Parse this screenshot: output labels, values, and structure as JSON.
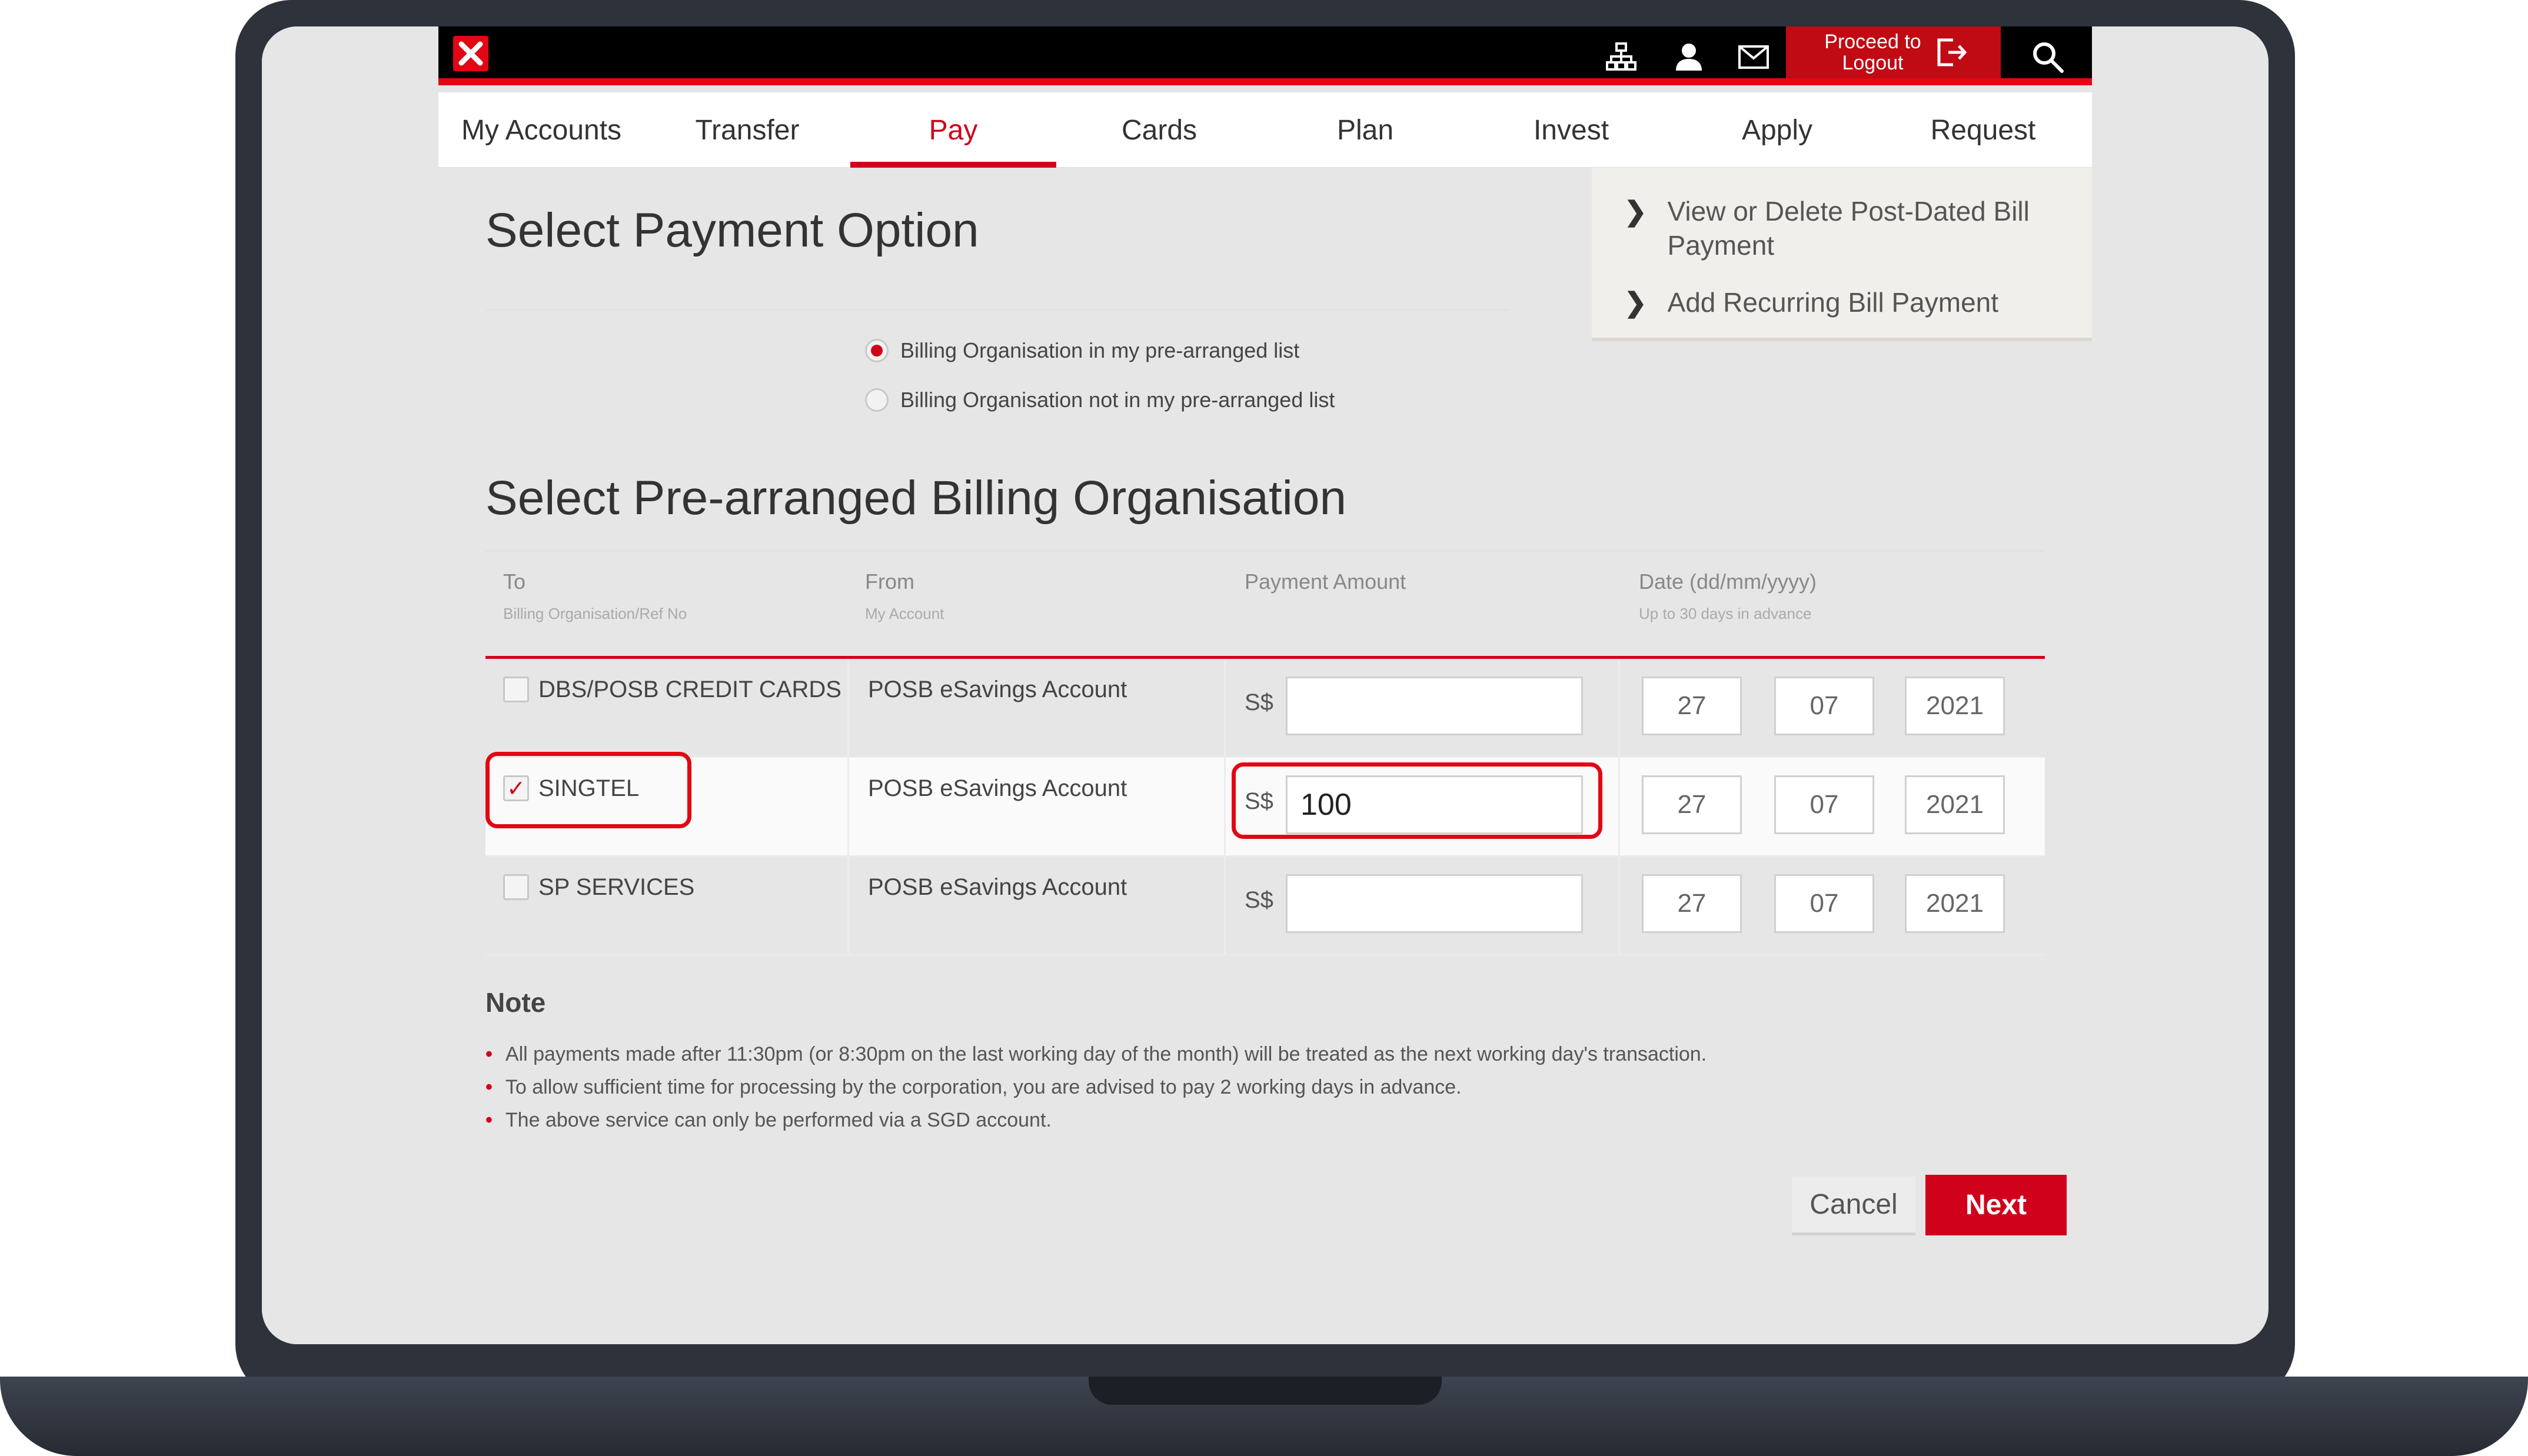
{
  "header": {
    "logout_line1": "Proceed to",
    "logout_line2": "Logout",
    "icons": [
      "sitemap-icon",
      "profile-icon",
      "mail-icon",
      "logout-icon",
      "search-icon"
    ],
    "brand_color": "#d0021b"
  },
  "nav": {
    "items": [
      "My Accounts",
      "Transfer",
      "Pay",
      "Cards",
      "Plan",
      "Invest",
      "Apply",
      "Request"
    ],
    "active": "Pay"
  },
  "payment_option": {
    "title": "Select Payment Option",
    "options": [
      {
        "label": "Billing Organisation in my pre-arranged list",
        "selected": true
      },
      {
        "label": "Billing Organisation not in my pre-arranged list",
        "selected": false
      }
    ]
  },
  "side_links": [
    "View or Delete Post-Dated Bill Payment",
    "Add Recurring Bill Payment"
  ],
  "billing": {
    "title": "Select Pre-arranged Billing Organisation",
    "headers": {
      "to": "To",
      "to_sub": "Billing Organisation/Ref No",
      "from": "From",
      "from_sub": "My Account",
      "amount": "Payment Amount",
      "date": "Date (dd/mm/yyyy)",
      "date_sub": "Up to 30 days in advance"
    },
    "rows": [
      {
        "org": "DBS/POSB CREDIT CARDS",
        "checked": false,
        "from": "POSB eSavings Account",
        "currency": "S$",
        "amount": "",
        "dd": "27",
        "mm": "07",
        "yyyy": "2021"
      },
      {
        "org": "SINGTEL",
        "checked": true,
        "from": "POSB eSavings Account",
        "currency": "S$",
        "amount": "100",
        "dd": "27",
        "mm": "07",
        "yyyy": "2021"
      },
      {
        "org": "SP SERVICES",
        "checked": false,
        "from": "POSB eSavings Account",
        "currency": "S$",
        "amount": "",
        "dd": "27",
        "mm": "07",
        "yyyy": "2021"
      }
    ]
  },
  "note": {
    "title": "Note",
    "items": [
      "All payments made after 11:30pm (or 8:30pm on the last working day of the month) will be treated as the next working day's transaction.",
      "To allow sufficient time for processing by the corporation, you are advised to pay 2 working days in advance.",
      "The above service can only be performed via a SGD account."
    ]
  },
  "actions": {
    "cancel": "Cancel",
    "next": "Next"
  }
}
